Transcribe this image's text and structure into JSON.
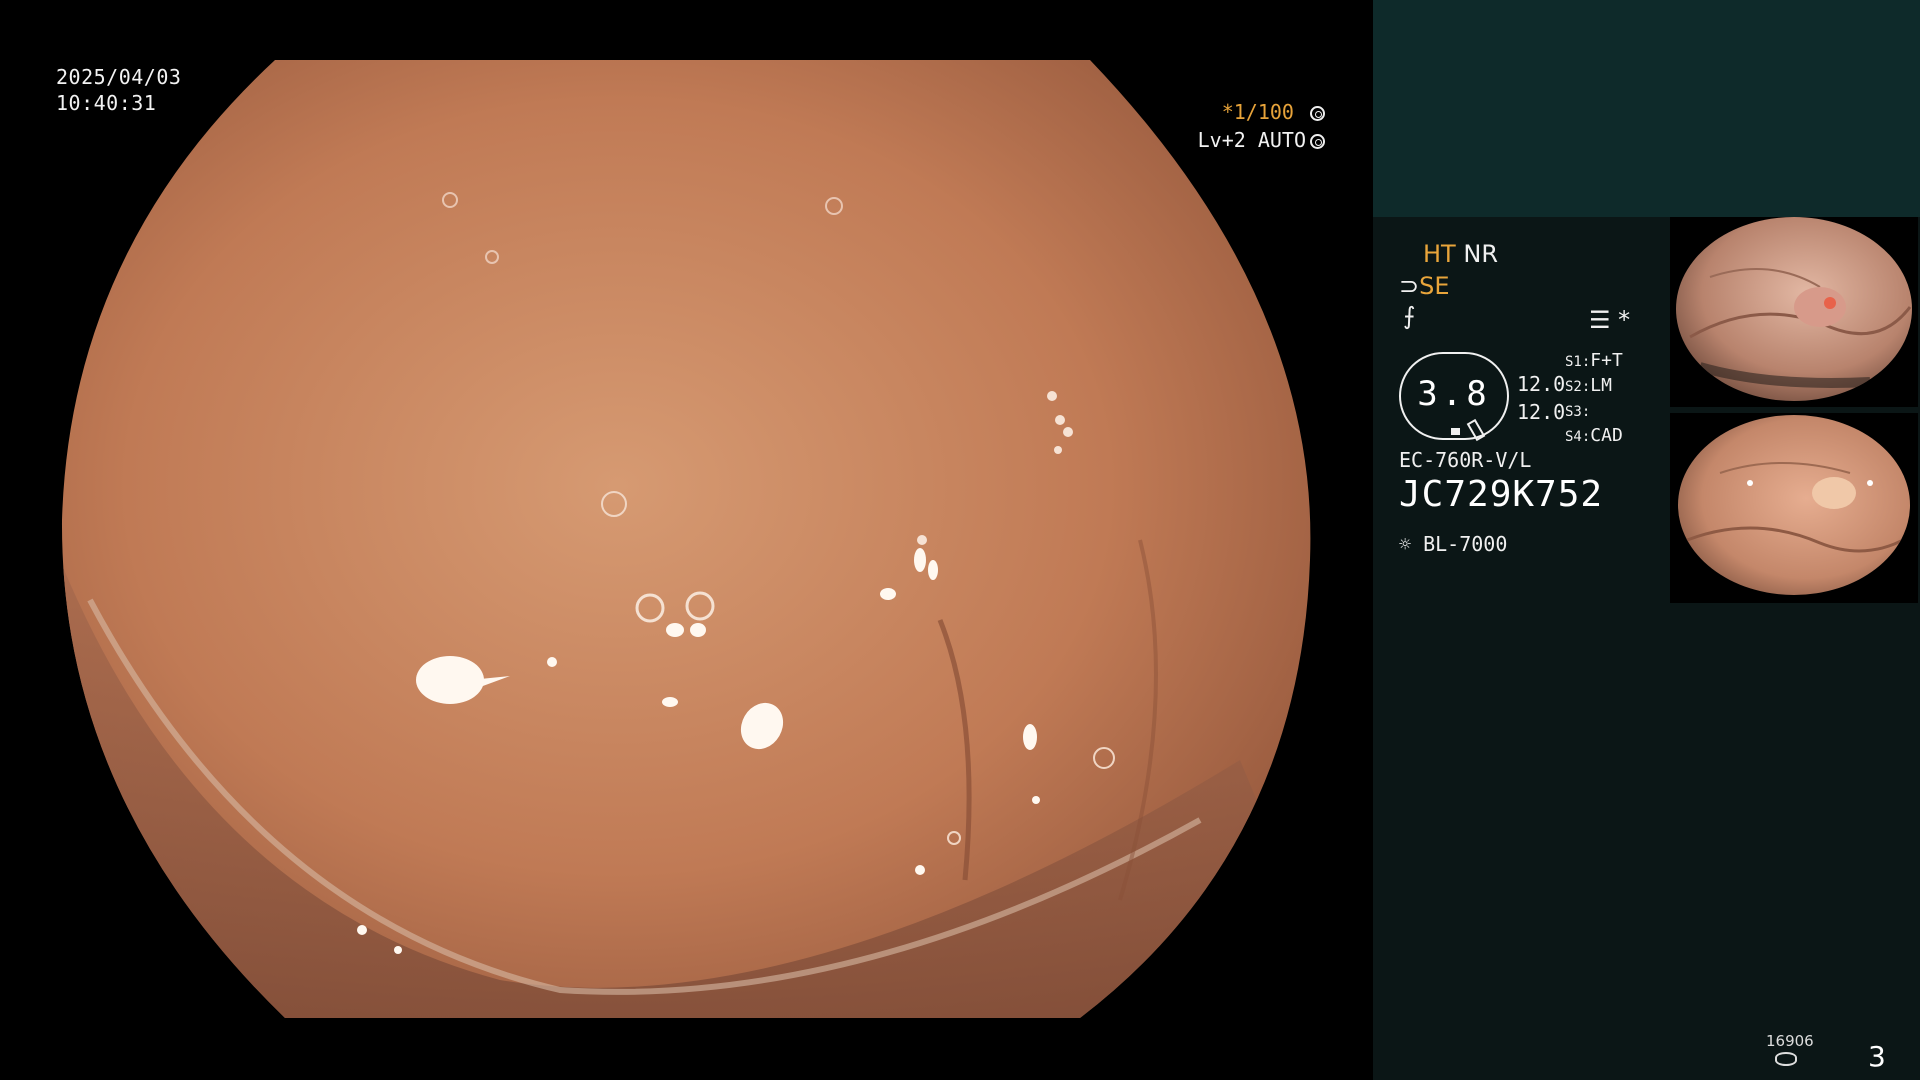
{
  "overlay": {
    "date": "2025/04/03",
    "time": "10:40:31",
    "shutter_value": "*1/100",
    "level": "Lv+2",
    "iris_mode": "AUTO"
  },
  "status": {
    "ht": "HT",
    "nr": "NR",
    "se": "SE",
    "gauge_value": "3.8",
    "val_a": "12.0",
    "val_b": "12.0",
    "s1_label": "S1:",
    "s1_value": "F+T",
    "s2_label": "S2:",
    "s2_value": "LM",
    "s3_label": "S3:",
    "s3_value": "",
    "s4_label": "S4:",
    "s4_value": "CAD",
    "asterisk": "*",
    "scope_model": "EC-760R-V/L",
    "serial": "JC729K752",
    "light_source": "BL-7000"
  },
  "footer": {
    "image_counter": "16906",
    "page_number": "3"
  },
  "icons": [
    "mode-sun-icon",
    "iris-ring-icon",
    "scope-symbol-icon",
    "freeze-symbol-icon",
    "menu-icon",
    "lamp-icon",
    "storage-icon"
  ],
  "colors": {
    "accent": "#e9a53b",
    "panel_top": "#0e2a2a",
    "panel": "#0b1616",
    "tissue": "#c9855f"
  }
}
